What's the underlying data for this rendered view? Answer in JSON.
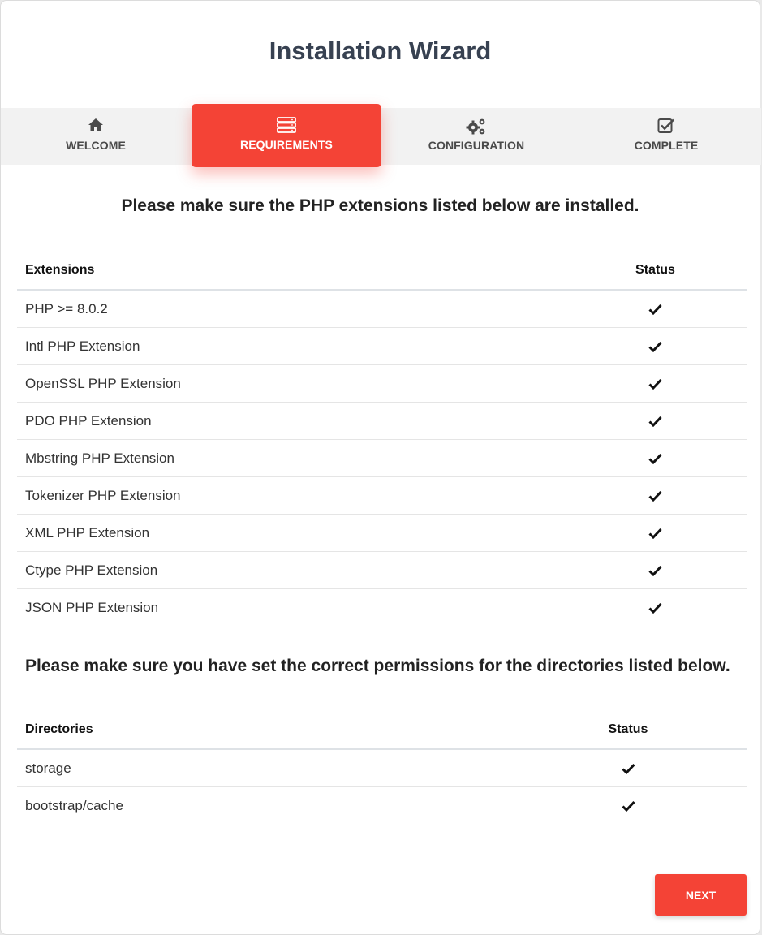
{
  "header": {
    "title": "Installation Wizard"
  },
  "steps": [
    {
      "label": "WELCOME",
      "icon": "home-icon",
      "active": false
    },
    {
      "label": "REQUIREMENTS",
      "icon": "server-icon",
      "active": true
    },
    {
      "label": "CONFIGURATION",
      "icon": "gears-icon",
      "active": false
    },
    {
      "label": "COMPLETE",
      "icon": "check-square-icon",
      "active": false
    }
  ],
  "extensions": {
    "heading": "Please make sure the PHP extensions listed below are installed.",
    "col_name": "Extensions",
    "col_status": "Status",
    "rows": [
      {
        "name": "PHP >= 8.0.2",
        "status": "check-icon"
      },
      {
        "name": "Intl PHP Extension",
        "status": "check-icon"
      },
      {
        "name": "OpenSSL PHP Extension",
        "status": "check-icon"
      },
      {
        "name": "PDO PHP Extension",
        "status": "check-icon"
      },
      {
        "name": "Mbstring PHP Extension",
        "status": "check-icon"
      },
      {
        "name": "Tokenizer PHP Extension",
        "status": "check-icon"
      },
      {
        "name": "XML PHP Extension",
        "status": "check-icon"
      },
      {
        "name": "Ctype PHP Extension",
        "status": "check-icon"
      },
      {
        "name": "JSON PHP Extension",
        "status": "check-icon"
      }
    ]
  },
  "directories": {
    "heading": "Please make sure you have set the correct permissions for the directories listed below.",
    "col_name": "Directories",
    "col_status": "Status",
    "rows": [
      {
        "name": "storage",
        "status": "check-icon"
      },
      {
        "name": "bootstrap/cache",
        "status": "check-icon"
      }
    ]
  },
  "actions": {
    "next_label": "NEXT"
  },
  "colors": {
    "accent": "#f44336",
    "title": "#374151",
    "step_bar": "#f2f2f2"
  }
}
